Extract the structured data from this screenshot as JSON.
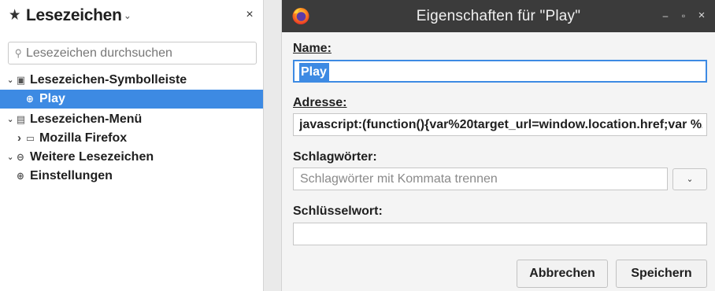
{
  "sidebar": {
    "title": "Lesezeichen",
    "title_caret": "⌄",
    "close": "×",
    "search": {
      "placeholder": "Lesezeichen durchsuchen",
      "icon": "search-icon"
    },
    "tree": [
      {
        "label": "Lesezeichen-Symbolleiste",
        "twisty": "⌄",
        "icon": "toolbar-folder-icon",
        "glyph": "▣",
        "depth": 0,
        "selected": false
      },
      {
        "label": "Play",
        "twisty": "",
        "icon": "globe-icon",
        "glyph": "⊕",
        "depth": 1,
        "selected": true
      },
      {
        "label": "Lesezeichen-Menü",
        "twisty": "⌄",
        "icon": "menu-folder-icon",
        "glyph": "▤",
        "depth": 0,
        "selected": false
      },
      {
        "label": "Mozilla Firefox",
        "twisty": "›",
        "icon": "folder-icon",
        "glyph": "▭",
        "depth": 1,
        "selected": false
      },
      {
        "label": "Weitere Lesezeichen",
        "twisty": "⌄",
        "icon": "other-bookmarks-icon",
        "glyph": "⊖",
        "depth": 0,
        "selected": false
      },
      {
        "label": "Einstellungen",
        "twisty": "",
        "icon": "globe-icon",
        "glyph": "⊕",
        "depth": 1,
        "selected": false
      }
    ]
  },
  "dialog": {
    "title": "Eigenschaften für \"Play\"",
    "window_buttons": {
      "minimize": "–",
      "maximize": "▫",
      "close": "×"
    },
    "name": {
      "label": "Name:",
      "value": "Play"
    },
    "address": {
      "label": "Adresse:",
      "value": "javascript:(function(){var%20target_url=window.location.href;var %2"
    },
    "tags": {
      "label": "Schlagwörter:",
      "placeholder": "Schlagwörter mit Kommata trennen",
      "dropdown": "⌄"
    },
    "keyword": {
      "label": "Schlüsselwort:",
      "value": ""
    },
    "buttons": {
      "cancel": "Abbrechen",
      "save": "Speichern"
    }
  },
  "colors": {
    "accent": "#3d8ae3",
    "titlebar": "#3b3b3b",
    "dialog_bg": "#f4f4f4"
  }
}
